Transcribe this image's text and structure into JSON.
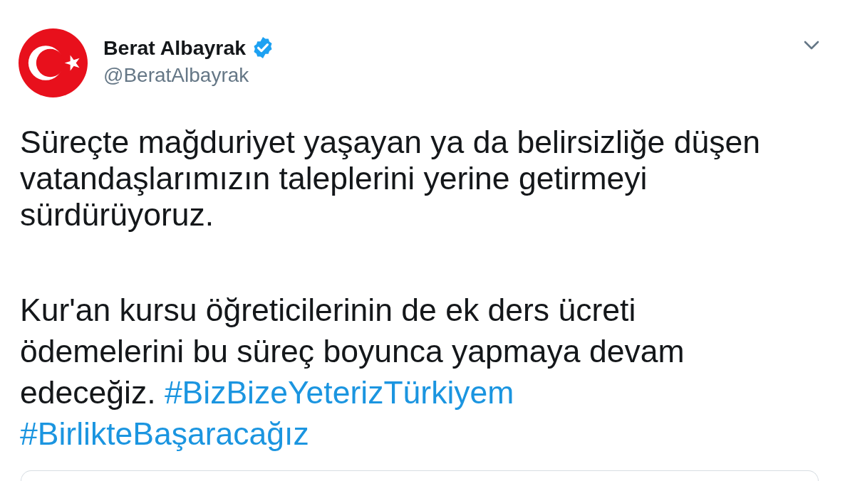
{
  "tweet": {
    "author": {
      "name": "Berat Albayrak",
      "verified": true,
      "handle": "@BeratAlbayrak"
    },
    "paragraphs": [
      [
        {
          "kind": "text",
          "text": "Süreçte mağduriyet yaşayan ya da belirsizliğe düşen vatandaşlarımızın taleplerini yerine getirmeyi sürdürüyoruz."
        }
      ],
      [
        {
          "kind": "text",
          "text": "Kur'an kursu öğreticilerinin de ek ders ücreti ödemelerini bu süreç boyunca yapmaya devam edeceğiz."
        },
        {
          "kind": "hashtag",
          "text": "#BizBizeYeterizTürkiyem"
        },
        {
          "kind": "hashtag",
          "text": "#BirlikteBaşaracağız"
        }
      ]
    ]
  }
}
